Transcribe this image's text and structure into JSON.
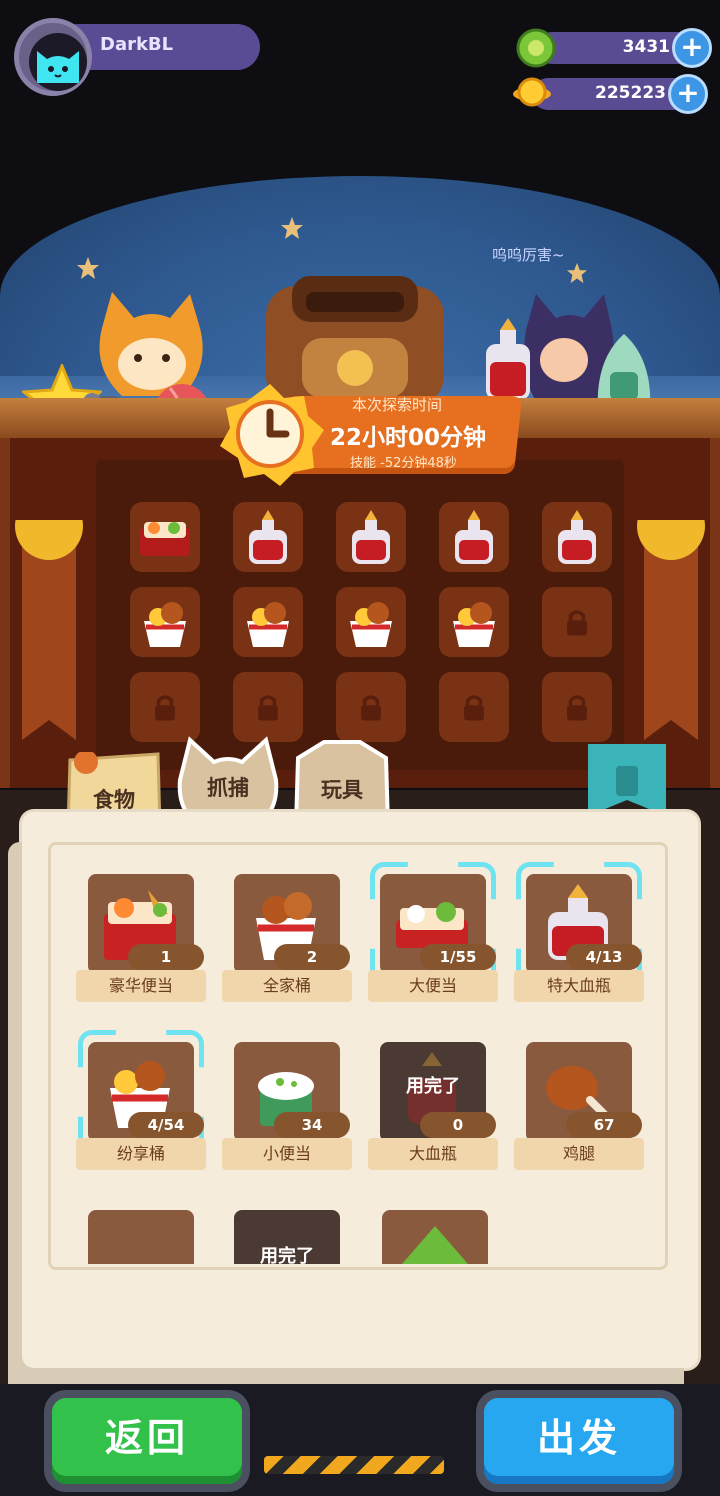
{
  "player": {
    "name": "DarkBL"
  },
  "currencies": [
    {
      "icon": "green-gem-icon",
      "value": "3431"
    },
    {
      "icon": "gold-coin-icon",
      "value": "225223"
    }
  ],
  "scene": {
    "speech": "呜呜厉害~",
    "explore": {
      "label": "本次探索时间",
      "time": "22小时00分钟",
      "skill": "技能 -52分钟48秒"
    }
  },
  "backpack_slots": [
    [
      "bento-deluxe",
      "potion-red",
      "potion-red",
      "potion-red",
      "potion-red"
    ],
    [
      "chicken-bucket",
      "chicken-bucket",
      "chicken-bucket",
      "chicken-bucket",
      "locked"
    ],
    [
      "locked",
      "locked",
      "locked",
      "locked",
      "locked"
    ]
  ],
  "tabs": [
    {
      "label": "食物"
    },
    {
      "label": "抓捕"
    },
    {
      "label": "玩具"
    }
  ],
  "items": [
    {
      "name": "豪华便当",
      "count": "1",
      "icon": "deluxe-bento-icon",
      "selected": false,
      "used_up": false
    },
    {
      "name": "全家桶",
      "count": "2",
      "icon": "family-bucket-icon",
      "selected": false,
      "used_up": false
    },
    {
      "name": "大便当",
      "count": "1/55",
      "icon": "large-bento-icon",
      "selected": true,
      "used_up": false
    },
    {
      "name": "特大血瓶",
      "count": "4/13",
      "icon": "extra-large-potion-icon",
      "selected": true,
      "used_up": false
    },
    {
      "name": "纷享桶",
      "count": "4/54",
      "icon": "sharing-bucket-icon",
      "selected": true,
      "used_up": false
    },
    {
      "name": "小便当",
      "count": "34",
      "icon": "small-bento-icon",
      "selected": false,
      "used_up": false
    },
    {
      "name": "大血瓶",
      "count": "0",
      "icon": "large-potion-icon",
      "selected": false,
      "used_up": true,
      "used_label": "用完了"
    },
    {
      "name": "鸡腿",
      "count": "67",
      "icon": "drumstick-icon",
      "selected": false,
      "used_up": false
    }
  ],
  "partial_row": {
    "used_label": "用完了"
  },
  "buttons": {
    "back": "返回",
    "go": "出发"
  },
  "colors": {
    "accent_green": "#32c24c",
    "accent_blue": "#27a7ef",
    "selection": "#6fe3f0"
  }
}
